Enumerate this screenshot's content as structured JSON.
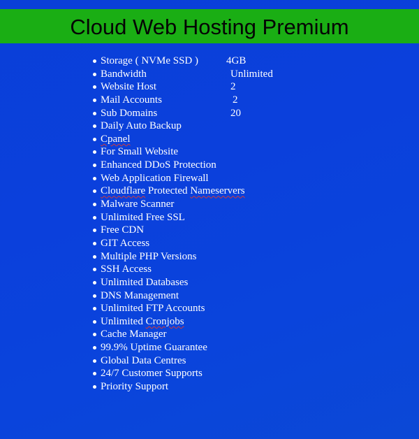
{
  "banner": {
    "title": "Cloud Web Hosting Premium",
    "background_color": "#1aae14",
    "text_color": "#050505"
  },
  "page": {
    "background_color": "#0b40dc"
  },
  "specs": [
    {
      "label": "Storage ( NVMe SSD )",
      "value": "4GB"
    },
    {
      "label": "Bandwidth",
      "value": "Unlimited"
    },
    {
      "label": "Website Host",
      "value": "2"
    },
    {
      "label": "Mail Accounts",
      "value": "2"
    },
    {
      "label": "Sub Domains",
      "value": "20"
    }
  ],
  "features": [
    {
      "text": "Daily Auto Backup"
    },
    {
      "pre": "",
      "flagged": "Cpanel",
      "post": ""
    },
    {
      "text": "For Small Website"
    },
    {
      "text": "Enhanced DDoS Protection"
    },
    {
      "text": "Web Application Firewall"
    },
    {
      "pre": "",
      "flagged": "Cloudflare",
      "mid": " Protected ",
      "flagged2": "Nameservers",
      "post": ""
    },
    {
      "text": "Malware Scanner"
    },
    {
      "text": "Unlimited Free SSL"
    },
    {
      "text": "Free CDN"
    },
    {
      "text": "GIT Access"
    },
    {
      "text": "Multiple PHP Versions"
    },
    {
      "text": "SSH Access"
    },
    {
      "text": "Unlimited Databases"
    },
    {
      "text": "DNS Management"
    },
    {
      "text": "Unlimited FTP Accounts"
    },
    {
      "pre": "Unlimited ",
      "flagged": "Cronjobs",
      "post": ""
    },
    {
      "text": "Cache Manager"
    },
    {
      "text": "99.9% Uptime Guarantee"
    },
    {
      "text": "Global Data Centres"
    },
    {
      "text": "24/7 Customer Supports"
    },
    {
      "text": "Priority Support"
    }
  ]
}
